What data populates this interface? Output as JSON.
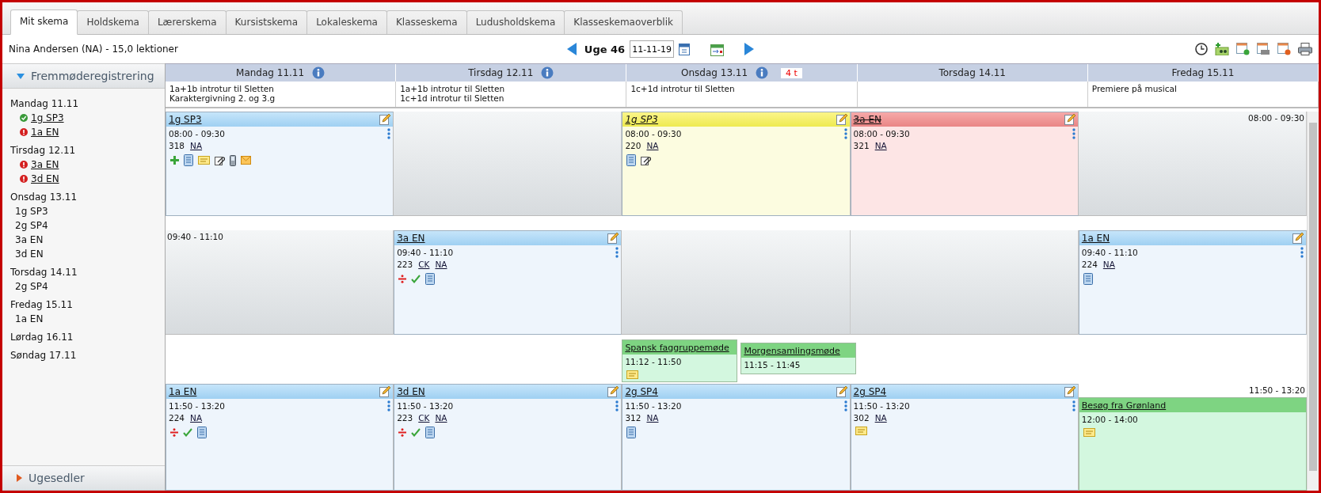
{
  "tabs": [
    {
      "label": "Mit skema",
      "selected": true
    },
    {
      "label": "Holdskema",
      "selected": false
    },
    {
      "label": "Lærerskema",
      "selected": false
    },
    {
      "label": "Kursistskema",
      "selected": false
    },
    {
      "label": "Lokaleskema",
      "selected": false
    },
    {
      "label": "Klasseskema",
      "selected": false
    },
    {
      "label": "Ludusholdskema",
      "selected": false
    },
    {
      "label": "Klasseskemaoverblik",
      "selected": false
    }
  ],
  "toolbar": {
    "user": "Nina Andersen (NA) - 15,0 lektioner",
    "week": "Uge 46",
    "date": "11-11-19"
  },
  "sidebar": [
    {
      "title": "Fremmøderegistrering",
      "expanded": true,
      "days": [
        {
          "label": "Mandag 11.11",
          "items": [
            {
              "label": "1g SP3",
              "kind": "registered"
            },
            {
              "label": "1a EN",
              "kind": "missing"
            }
          ]
        },
        {
          "label": "Tirsdag 12.11",
          "items": [
            {
              "label": "3a EN",
              "kind": "missing"
            },
            {
              "label": "3d EN",
              "kind": "missing"
            }
          ]
        },
        {
          "label": "Onsdag 13.11",
          "items": [
            {
              "label": "1g SP3",
              "kind": "plain"
            },
            {
              "label": "2g SP4",
              "kind": "plain"
            },
            {
              "label": "3a EN",
              "kind": "plain"
            },
            {
              "label": "3d EN",
              "kind": "plain"
            }
          ]
        },
        {
          "label": "Torsdag 14.11",
          "items": [
            {
              "label": "2g SP4",
              "kind": "plain"
            }
          ]
        },
        {
          "label": "Fredag 15.11",
          "items": [
            {
              "label": "1a EN",
              "kind": "plain"
            }
          ]
        },
        {
          "label": "Lørdag 16.11"
        },
        {
          "label": "Søndag 17.11"
        }
      ]
    },
    {
      "title": "Ugesedler",
      "expanded": false
    }
  ],
  "days": [
    {
      "label": "Mandag 11.11",
      "info": true,
      "notes": [
        "1a+1b introtur til Sletten",
        "Karaktergivning 2. og 3.g"
      ]
    },
    {
      "label": "Tirsdag 12.11",
      "info": true,
      "notes": [
        "1a+1b introtur til Sletten",
        "1c+1d introtur til Sletten"
      ]
    },
    {
      "label": "Onsdag 13.11",
      "info": true,
      "badge": "4 t",
      "notes": [
        "1c+1d introtur til Sletten"
      ]
    },
    {
      "label": "Torsdag 14.11",
      "info": false
    },
    {
      "label": "Fredag 15.11",
      "info": false,
      "notes": [
        "Premiere på musical"
      ]
    }
  ],
  "rows": [
    {
      "kind": "band",
      "cells": [
        {
          "kind": "lesson",
          "changed": false,
          "cancelled": false,
          "title": "1g SP3",
          "time": "08:00 - 09:30",
          "room": "318",
          "teachers": [
            "NA"
          ],
          "icons": [
            {
              "kind": "plus"
            },
            {
              "kind": "document"
            },
            {
              "kind": "note"
            },
            {
              "kind": "clip"
            },
            {
              "kind": "phone"
            },
            {
              "kind": "mail"
            }
          ]
        },
        {
          "kind": "empty"
        },
        {
          "kind": "lesson",
          "changed": true,
          "cancelled": false,
          "title": "1g SP3",
          "time": "08:00 - 09:30",
          "room": "220",
          "teachers": [
            "NA"
          ],
          "icons": [
            {
              "kind": "document"
            },
            {
              "kind": "clip"
            }
          ]
        },
        {
          "kind": "lesson",
          "changed": false,
          "cancelled": true,
          "title": "3a EN",
          "time": "08:00 - 09:30",
          "room": "321",
          "teachers": [
            "NA"
          ]
        },
        {
          "kind": "empty",
          "time": "08:00 - 09:30"
        }
      ]
    },
    {
      "kind": "gap"
    },
    {
      "kind": "band",
      "cells": [
        {
          "kind": "empty",
          "time": "09:40 - 11:10"
        },
        {
          "kind": "lesson",
          "changed": false,
          "cancelled": false,
          "title": "3a EN",
          "time": "09:40 - 11:10",
          "room": "223",
          "teachers": [
            "CK",
            "NA"
          ],
          "icons": [
            {
              "kind": "divide"
            },
            {
              "kind": "check"
            },
            {
              "kind": "document"
            }
          ]
        },
        {
          "kind": "empty"
        },
        {
          "kind": "empty"
        },
        {
          "kind": "lesson",
          "changed": false,
          "cancelled": false,
          "title": "1a EN",
          "time": "09:40 - 11:10",
          "room": "224",
          "teachers": [
            "NA"
          ],
          "icons": [
            {
              "kind": "document"
            }
          ]
        }
      ]
    },
    {
      "kind": "gap",
      "cells": [
        {
          "kind": "empty"
        },
        {
          "kind": "empty"
        },
        {
          "kind": "meetings",
          "meetings": [
            {
              "title": "Spansk faggruppemøde",
              "time": "11:12 - 11:50",
              "icons": [
                {
                  "kind": "note"
                }
              ]
            },
            {
              "title": "Morgensamlingsmøde",
              "time": "11:15 - 11:45"
            }
          ]
        },
        {
          "kind": "empty"
        },
        {
          "kind": "empty"
        }
      ]
    },
    {
      "kind": "band",
      "cells": [
        {
          "kind": "lesson",
          "changed": false,
          "cancelled": false,
          "title": "1a EN",
          "time": "11:50 - 13:20",
          "room": "224",
          "teachers": [
            "NA"
          ],
          "icons": [
            {
              "kind": "divide"
            },
            {
              "kind": "check"
            },
            {
              "kind": "document"
            }
          ]
        },
        {
          "kind": "lesson",
          "changed": false,
          "cancelled": false,
          "title": "3d EN",
          "time": "11:50 - 13:20",
          "room": "223",
          "teachers": [
            "CK",
            "NA"
          ],
          "icons": [
            {
              "kind": "divide"
            },
            {
              "kind": "check"
            },
            {
              "kind": "document"
            }
          ]
        },
        {
          "kind": "lesson",
          "changed": false,
          "cancelled": false,
          "title": "2g SP4",
          "time": "11:50 - 13:20",
          "room": "312",
          "teachers": [
            "NA"
          ],
          "icons": [
            {
              "kind": "document"
            }
          ]
        },
        {
          "kind": "lesson",
          "changed": false,
          "cancelled": false,
          "title": "2g SP4",
          "time": "11:50 - 13:20",
          "room": "302",
          "teachers": [
            "NA"
          ],
          "icons": [
            {
              "kind": "note"
            }
          ]
        },
        {
          "kind": "event",
          "time": "11:50 - 13:20",
          "event": {
            "title": "Besøg fra Grønland",
            "time": "12:00 - 14:00",
            "icons": [
              {
                "kind": "note"
              }
            ]
          }
        }
      ]
    }
  ]
}
